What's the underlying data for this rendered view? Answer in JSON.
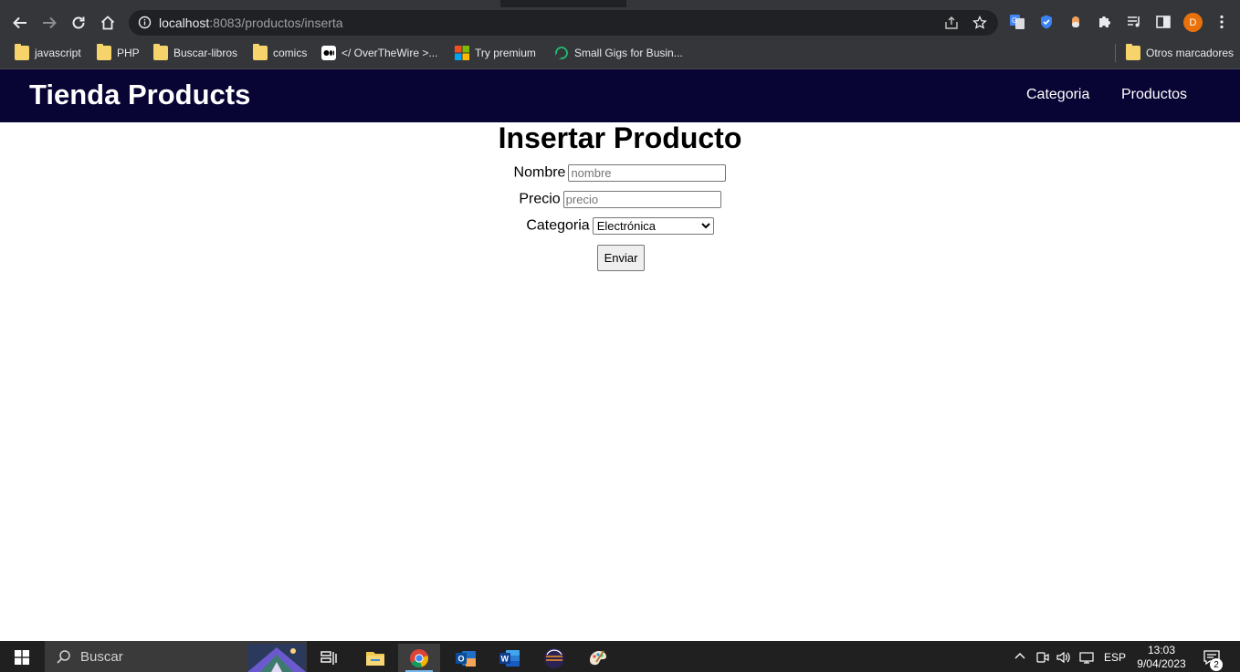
{
  "browser": {
    "url_host": "localhost",
    "url_rest": ":8083/productos/inserta",
    "profile_initial": "D",
    "bookmarks": [
      {
        "label": "javascript",
        "icon": "folder-icon"
      },
      {
        "label": "PHP",
        "icon": "folder-icon"
      },
      {
        "label": "Buscar-libros",
        "icon": "folder-icon"
      },
      {
        "label": "comics",
        "icon": "folder-icon"
      },
      {
        "label": "</ OverTheWire >...",
        "icon": "medium-icon"
      },
      {
        "label": "Try premium",
        "icon": "microsoft-icon"
      },
      {
        "label": "Small Gigs for Busin...",
        "icon": "fiverr-icon"
      }
    ],
    "other_bookmarks": "Otros marcadores"
  },
  "site": {
    "brand": "Tienda Products",
    "nav": [
      "Categoria",
      "Productos"
    ]
  },
  "form": {
    "title": "Insertar Producto",
    "nombre_label": "Nombre",
    "nombre_placeholder": "nombre",
    "precio_label": "Precio",
    "precio_placeholder": "precio",
    "categoria_label": "Categoria",
    "categoria_selected": "Electrónica",
    "submit_label": "Enviar"
  },
  "taskbar": {
    "search_placeholder": "Buscar",
    "apps": [
      "task-view-icon",
      "file-explorer-icon",
      "chrome-icon",
      "outlook-icon",
      "word-icon",
      "eclipse-icon",
      "paint-icon"
    ],
    "language": "ESP",
    "time": "13:03",
    "date": "9/04/2023",
    "notifications": "2"
  },
  "colors": {
    "site_nav_bg": "#080434",
    "browser_toolbar": "#35363a",
    "taskbar_bg": "#202020"
  }
}
